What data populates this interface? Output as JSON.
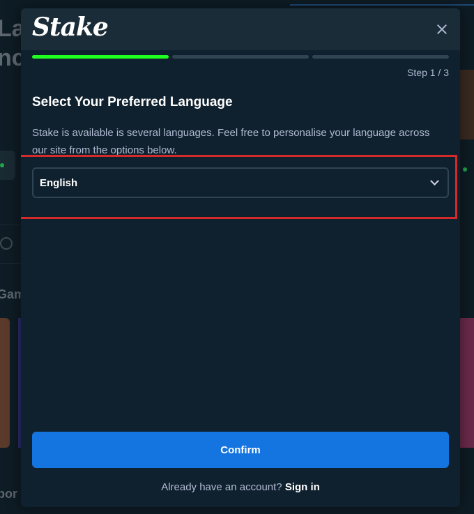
{
  "background": {
    "title_line1": "La",
    "title_line2": "nc",
    "section_label": "Gam",
    "bottom_label": "por"
  },
  "modal": {
    "logo_text": "Stake",
    "progress": {
      "current_step": 1,
      "total_steps": 3
    },
    "step_label": "Step 1 / 3",
    "heading": "Select Your Preferred Language",
    "description": "Stake is available is several languages. Feel free to personalise your language across our site from the options below.",
    "language_select": {
      "selected": "English"
    },
    "confirm_label": "Confirm",
    "signin_prompt": "Already have an account?",
    "signin_link": "Sign in"
  },
  "colors": {
    "modal_bg": "#0f212e",
    "header_bg": "#1a2c38",
    "progress_active": "#1fff20",
    "progress_inactive": "#2f4553",
    "confirm_button": "#1475e1",
    "highlight_border": "#d42a2a"
  },
  "icons": {
    "close": "close-icon",
    "dropdown": "chevron-down-icon",
    "search": "search-icon"
  }
}
